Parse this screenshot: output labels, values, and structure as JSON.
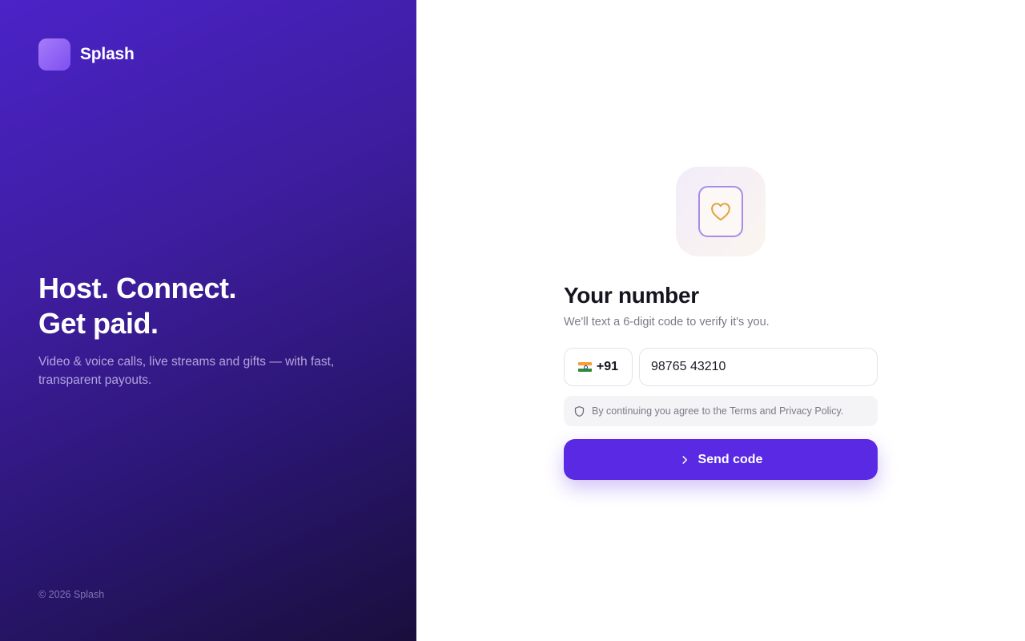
{
  "brand": {
    "name": "Splash",
    "logo_icon": "app-logo-icon"
  },
  "hero": {
    "title_line1": "Host. Connect.",
    "title_line2": "Get paid.",
    "subtitle": "Video & voice calls, live streams and gifts — with fast, transparent payouts.",
    "copyright": "© 2026 Splash"
  },
  "form": {
    "icon": "heart-card-icon",
    "title": "Your number",
    "subtitle": "We'll text a 6-digit code to verify it's you.",
    "country": {
      "flag": "india-flag-icon",
      "code": "+91"
    },
    "phone": {
      "value": "98765 43210"
    },
    "notice": {
      "icon": "shield-icon",
      "text": "By continuing you agree to the Terms and Privacy Policy."
    },
    "submit": {
      "icon": "chevron-right-icon",
      "label": "Send code"
    }
  },
  "colors": {
    "brand_primary": "#5a29e4",
    "hero_gradient_start": "#4b23c8",
    "hero_gradient_end": "#1a0e3c",
    "heart": "#e3a43c"
  }
}
